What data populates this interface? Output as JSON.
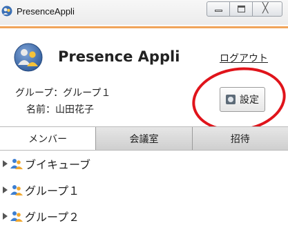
{
  "window": {
    "title": "PresenceAppli",
    "controls": {
      "minimize_glyph": "minimize-icon",
      "maximize_glyph": "maximize-icon",
      "close_glyph": "╳"
    }
  },
  "header": {
    "app_name": "Presence Appli",
    "logout_label": "ログアウト",
    "group_line": "グループ：グループ１",
    "name_line": "名前：山田花子",
    "settings_label": "設定"
  },
  "tabs": [
    {
      "label": "メンバー",
      "active": true
    },
    {
      "label": "会議室",
      "active": false
    },
    {
      "label": "招待",
      "active": false
    }
  ],
  "groups": [
    {
      "label": "ブイキューブ"
    },
    {
      "label": "グループ１"
    },
    {
      "label": "グループ２"
    }
  ],
  "colors": {
    "accent": "#f0a45a",
    "annotation": "#e0141b"
  }
}
